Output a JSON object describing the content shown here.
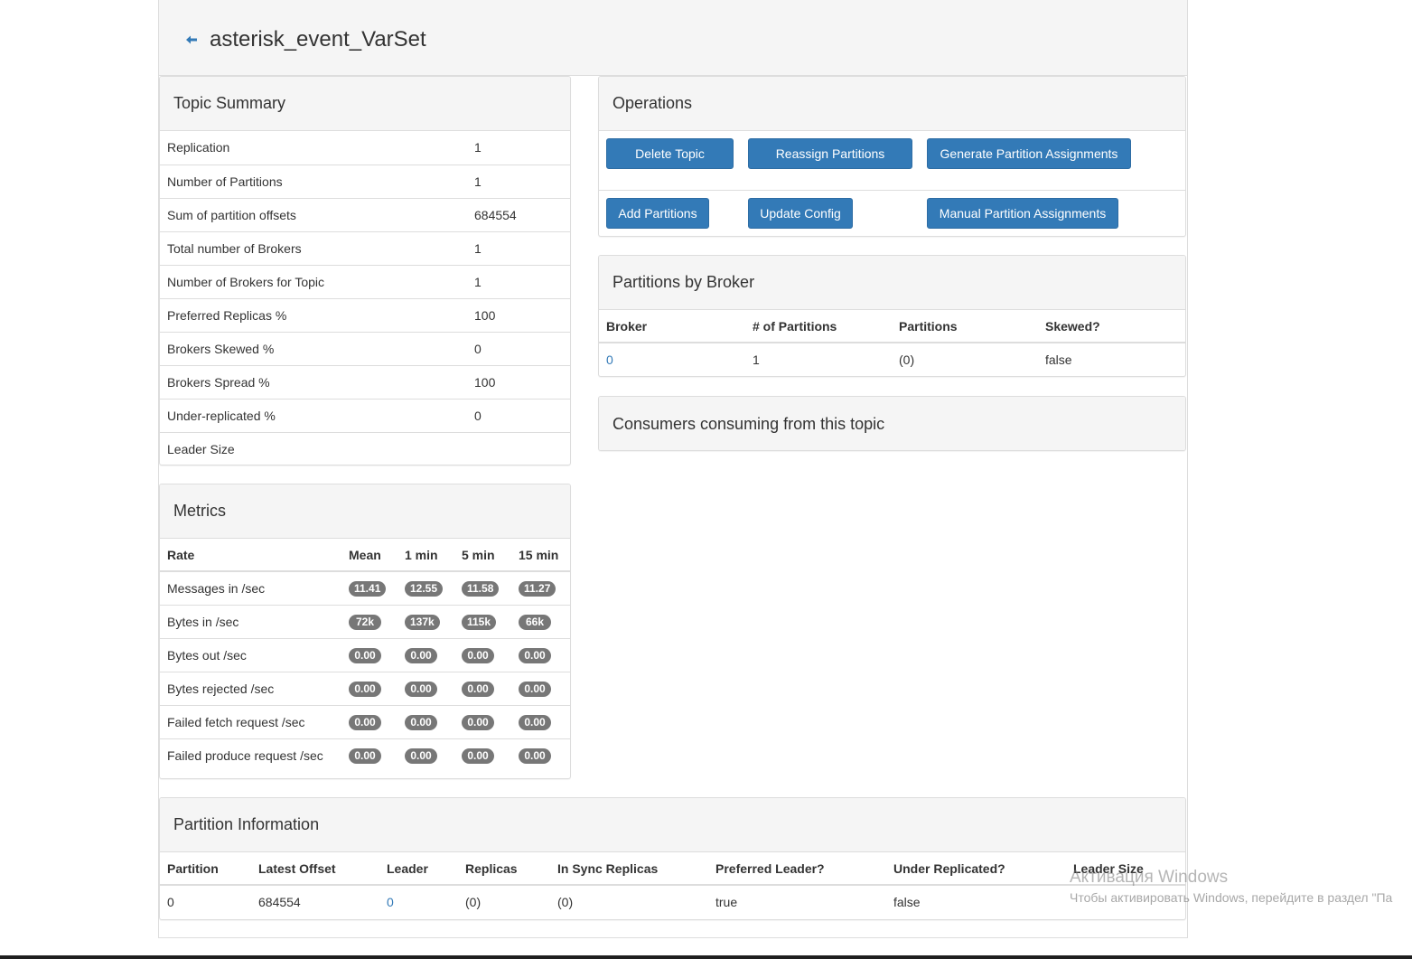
{
  "header": {
    "title": "asterisk_event_VarSet"
  },
  "topic_summary": {
    "title": "Topic Summary",
    "rows": [
      {
        "label": "Replication",
        "value": "1"
      },
      {
        "label": "Number of Partitions",
        "value": "1"
      },
      {
        "label": "Sum of partition offsets",
        "value": "684554"
      },
      {
        "label": "Total number of Brokers",
        "value": "1"
      },
      {
        "label": "Number of Brokers for Topic",
        "value": "1"
      },
      {
        "label": "Preferred Replicas %",
        "value": "100"
      },
      {
        "label": "Brokers Skewed %",
        "value": "0"
      },
      {
        "label": "Brokers Spread %",
        "value": "100"
      },
      {
        "label": "Under-replicated %",
        "value": "0"
      },
      {
        "label": "Leader Size",
        "value": ""
      }
    ]
  },
  "operations": {
    "title": "Operations",
    "buttons": {
      "delete_topic": "Delete Topic",
      "reassign_partitions": "Reassign Partitions",
      "generate_assignments": "Generate Partition Assignments",
      "add_partitions": "Add Partitions",
      "update_config": "Update Config",
      "manual_assignments": "Manual Partition Assignments"
    }
  },
  "partitions_by_broker": {
    "title": "Partitions by Broker",
    "headers": [
      "Broker",
      "# of Partitions",
      "Partitions",
      "Skewed?"
    ],
    "rows": [
      {
        "broker": "0",
        "num_partitions": "1",
        "partitions": "(0)",
        "skewed": "false"
      }
    ]
  },
  "consumers": {
    "title": "Consumers consuming from this topic"
  },
  "metrics": {
    "title": "Metrics",
    "headers": [
      "Rate",
      "Mean",
      "1 min",
      "5 min",
      "15 min"
    ],
    "rows": [
      {
        "rate": "Messages in /sec",
        "mean": "11.41",
        "m1": "12.55",
        "m5": "11.58",
        "m15": "11.27"
      },
      {
        "rate": "Bytes in /sec",
        "mean": "72k",
        "m1": "137k",
        "m5": "115k",
        "m15": "66k"
      },
      {
        "rate": "Bytes out /sec",
        "mean": "0.00",
        "m1": "0.00",
        "m5": "0.00",
        "m15": "0.00"
      },
      {
        "rate": "Bytes rejected /sec",
        "mean": "0.00",
        "m1": "0.00",
        "m5": "0.00",
        "m15": "0.00"
      },
      {
        "rate": "Failed fetch request /sec",
        "mean": "0.00",
        "m1": "0.00",
        "m5": "0.00",
        "m15": "0.00"
      },
      {
        "rate": "Failed produce request /sec",
        "mean": "0.00",
        "m1": "0.00",
        "m5": "0.00",
        "m15": "0.00"
      }
    ]
  },
  "partition_info": {
    "title": "Partition Information",
    "headers": [
      "Partition",
      "Latest Offset",
      "Leader",
      "Replicas",
      "In Sync Replicas",
      "Preferred Leader?",
      "Under Replicated?",
      "Leader Size"
    ],
    "rows": [
      {
        "partition": "0",
        "latest_offset": "684554",
        "leader": "0",
        "replicas": "(0)",
        "isr": "(0)",
        "preferred_leader": "true",
        "under_replicated": "false",
        "leader_size": ""
      }
    ]
  },
  "watermark": {
    "line1": "Активация Windows",
    "line2": "Чтобы активировать Windows, перейдите в раздел \"Па"
  },
  "colors": {
    "primary": "#337ab7",
    "badge": "#777777",
    "panel_heading": "#f5f5f5"
  }
}
